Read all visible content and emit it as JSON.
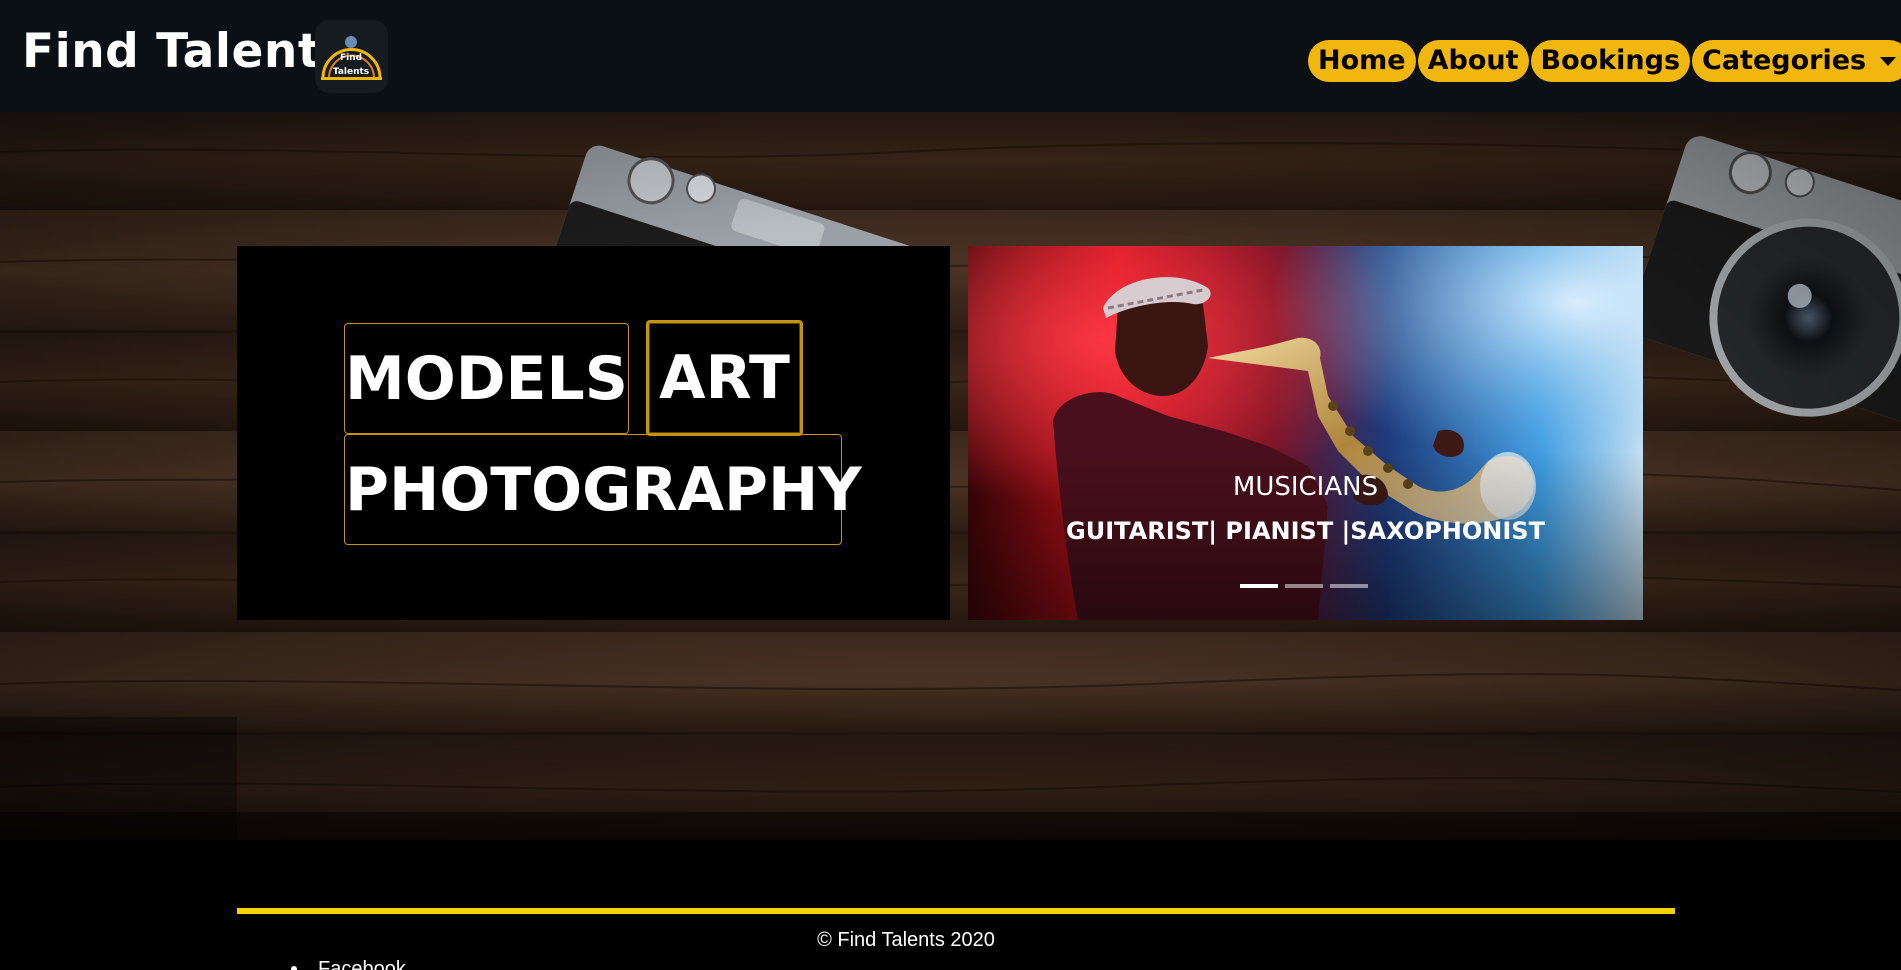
{
  "header": {
    "brand": "Find Talents",
    "logo_text_top": "Find",
    "logo_text_bottom": "Talents",
    "nav": [
      {
        "label": "Home"
      },
      {
        "label": "About"
      },
      {
        "label": "Bookings"
      },
      {
        "label": "Categories"
      }
    ]
  },
  "hero": {
    "tags": [
      "MODELS",
      "ART",
      "PHOTOGRAPHY"
    ]
  },
  "carousel": {
    "title": "MUSICIANS",
    "subtitle": "GUITARIST| PIANIST |SAXOPHONIST",
    "slides_total": 3,
    "active_slide": 1
  },
  "footer": {
    "copyright": "© Find Talents 2020",
    "social_link": "Facebook"
  },
  "colors": {
    "accent": "#f2b70e",
    "navbar": "#0b1014",
    "footer_line": "#f5d20a",
    "tag_border": "#c49410"
  }
}
